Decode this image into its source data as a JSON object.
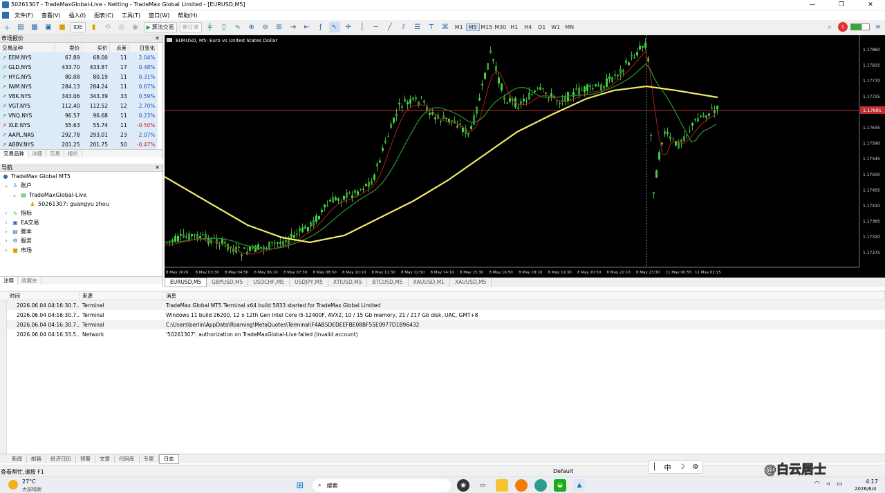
{
  "window": {
    "title": "50261307 - TradeMaxGlobal-Live - Netting - TradeMax Global Limited - [EURUSD,M5]"
  },
  "menu": [
    "文件(F)",
    "查看(V)",
    "插入(I)",
    "图表(C)",
    "工具(T)",
    "窗口(W)",
    "帮助(H)"
  ],
  "toolbar": {
    "ide": "IDE",
    "algo": "算法交易",
    "neworder": "新订单",
    "timeframes": [
      "M1",
      "M5",
      "M15",
      "M30",
      "H1",
      "H4",
      "D1",
      "W1",
      "MN"
    ],
    "active_tf": "M5",
    "notif_count": "1"
  },
  "market_watch": {
    "title": "市场报价",
    "headers": [
      "交易品种",
      "卖价",
      "买价",
      "点差",
      "日变化"
    ],
    "rows": [
      {
        "sym": "EEM.NYS",
        "bid": "67.89",
        "ask": "68.00",
        "spread": "11",
        "chg": "2.04%",
        "neg": false
      },
      {
        "sym": "GLD.NYS",
        "bid": "433.70",
        "ask": "433.87",
        "spread": "17",
        "chg": "0.48%",
        "neg": false
      },
      {
        "sym": "HYG.NYS",
        "bid": "80.08",
        "ask": "80.19",
        "spread": "11",
        "chg": "0.31%",
        "neg": false
      },
      {
        "sym": "IWM.NYS",
        "bid": "284.13",
        "ask": "284.24",
        "spread": "11",
        "chg": "0.67%",
        "neg": false
      },
      {
        "sym": "VBK.NYS",
        "bid": "343.06",
        "ask": "343.39",
        "spread": "33",
        "chg": "0.59%",
        "neg": false
      },
      {
        "sym": "VGT.NYS",
        "bid": "112.40",
        "ask": "112.52",
        "spread": "12",
        "chg": "2.70%",
        "neg": false
      },
      {
        "sym": "VNQ.NYS",
        "bid": "96.57",
        "ask": "96.68",
        "spread": "11",
        "chg": "0.23%",
        "neg": false
      },
      {
        "sym": "XLE.NYS",
        "bid": "55.63",
        "ask": "55.74",
        "spread": "11",
        "chg": "-0.50%",
        "neg": true
      },
      {
        "sym": "AAPL.NAS",
        "bid": "292.78",
        "ask": "293.01",
        "spread": "23",
        "chg": "2.07%",
        "neg": false
      },
      {
        "sym": "ABBV.NYS",
        "bid": "201.25",
        "ask": "201.75",
        "spread": "50",
        "chg": "-0.47%",
        "neg": true
      }
    ],
    "tabs": [
      "交易品种",
      "详细",
      "交易",
      "报价"
    ]
  },
  "navigator": {
    "title": "导航",
    "items": [
      "TradeMax Global MT5",
      "账户",
      "TradeMaxGlobal-Live",
      "50261307: guangyu zhou",
      "指标",
      "EA交易",
      "脚本",
      "服务",
      "市场"
    ],
    "tabs": [
      "注释",
      "收藏夹"
    ]
  },
  "chart": {
    "header": "EURUSD, M5: Euro vs United States Dollar",
    "price_label": "1.17681",
    "y_ticks": [
      "1.17860",
      "1.17815",
      "1.17770",
      "1.17725",
      "1.17680",
      "1.17635",
      "1.17590",
      "1.17545",
      "1.17500",
      "1.17455",
      "1.17410",
      "1.17365",
      "1.17320",
      "1.17275"
    ],
    "x_ticks": [
      "8 May 2026",
      "8 May 03:30",
      "8 May 04:50",
      "8 May 06:10",
      "8 May 07:30",
      "8 May 08:50",
      "8 May 10:10",
      "8 May 11:30",
      "8 May 12:50",
      "8 May 14:10",
      "8 May 15:30",
      "8 May 16:50",
      "8 May 18:10",
      "8 May 19:30",
      "8 May 20:50",
      "8 May 22:10",
      "8 May 23:30",
      "11 May 00:55",
      "11 May 02:15"
    ],
    "tabs": [
      "EURUSD,M5",
      "GBPUSD,M5",
      "USDCHF,M5",
      "USDJPY,M5",
      "XTIUSD,M5",
      "BTCUSD,M5",
      "XAUUSD,M1",
      "XAUUSD,M5"
    ]
  },
  "journal": {
    "headers": [
      "时间",
      "来源",
      "消息"
    ],
    "rows": [
      {
        "time": "2026.06.04 04:16:30.7...",
        "src": "Terminal",
        "msg": "TradeMax Global MT5 Terminal x64 build 5833 started for TradeMax Global Limited",
        "err": false
      },
      {
        "time": "2026.06.04 04:16:30.7...",
        "src": "Terminal",
        "msg": "Windows 11 build 26200, 12 x 12th Gen Intel Core i5-12400F, AVX2, 10 / 15 Gb memory, 21 / 217 Gb disk, UAC, GMT+8",
        "err": false
      },
      {
        "time": "2026.06.04 04:16:30.7...",
        "src": "Terminal",
        "msg": "C:\\Users\\berlin\\AppData\\Roaming\\MetaQuotes\\Terminal\\F4AB5DEDEEFBE08BF55E0977D1B96432",
        "err": false
      },
      {
        "time": "2026.06.04 04:16:33.5...",
        "src": "Network",
        "msg": "'50261307': authorization on TradeMaxGlobal-Live failed (Invalid account)",
        "err": true
      }
    ],
    "tabs": [
      "新闻",
      "邮箱",
      "经济日历",
      "预警",
      "文章",
      "代码库",
      "专家",
      "日志"
    ]
  },
  "status": {
    "help": "查看帮忙,请按 F1",
    "profile": "Default"
  },
  "taskbar": {
    "temp": "27°C",
    "weather": "大部晴朗",
    "search": "搜索",
    "time": "4:17",
    "date": "2026/6/4"
  },
  "ime": {
    "label": "中"
  },
  "watermark": "@白云居士"
}
